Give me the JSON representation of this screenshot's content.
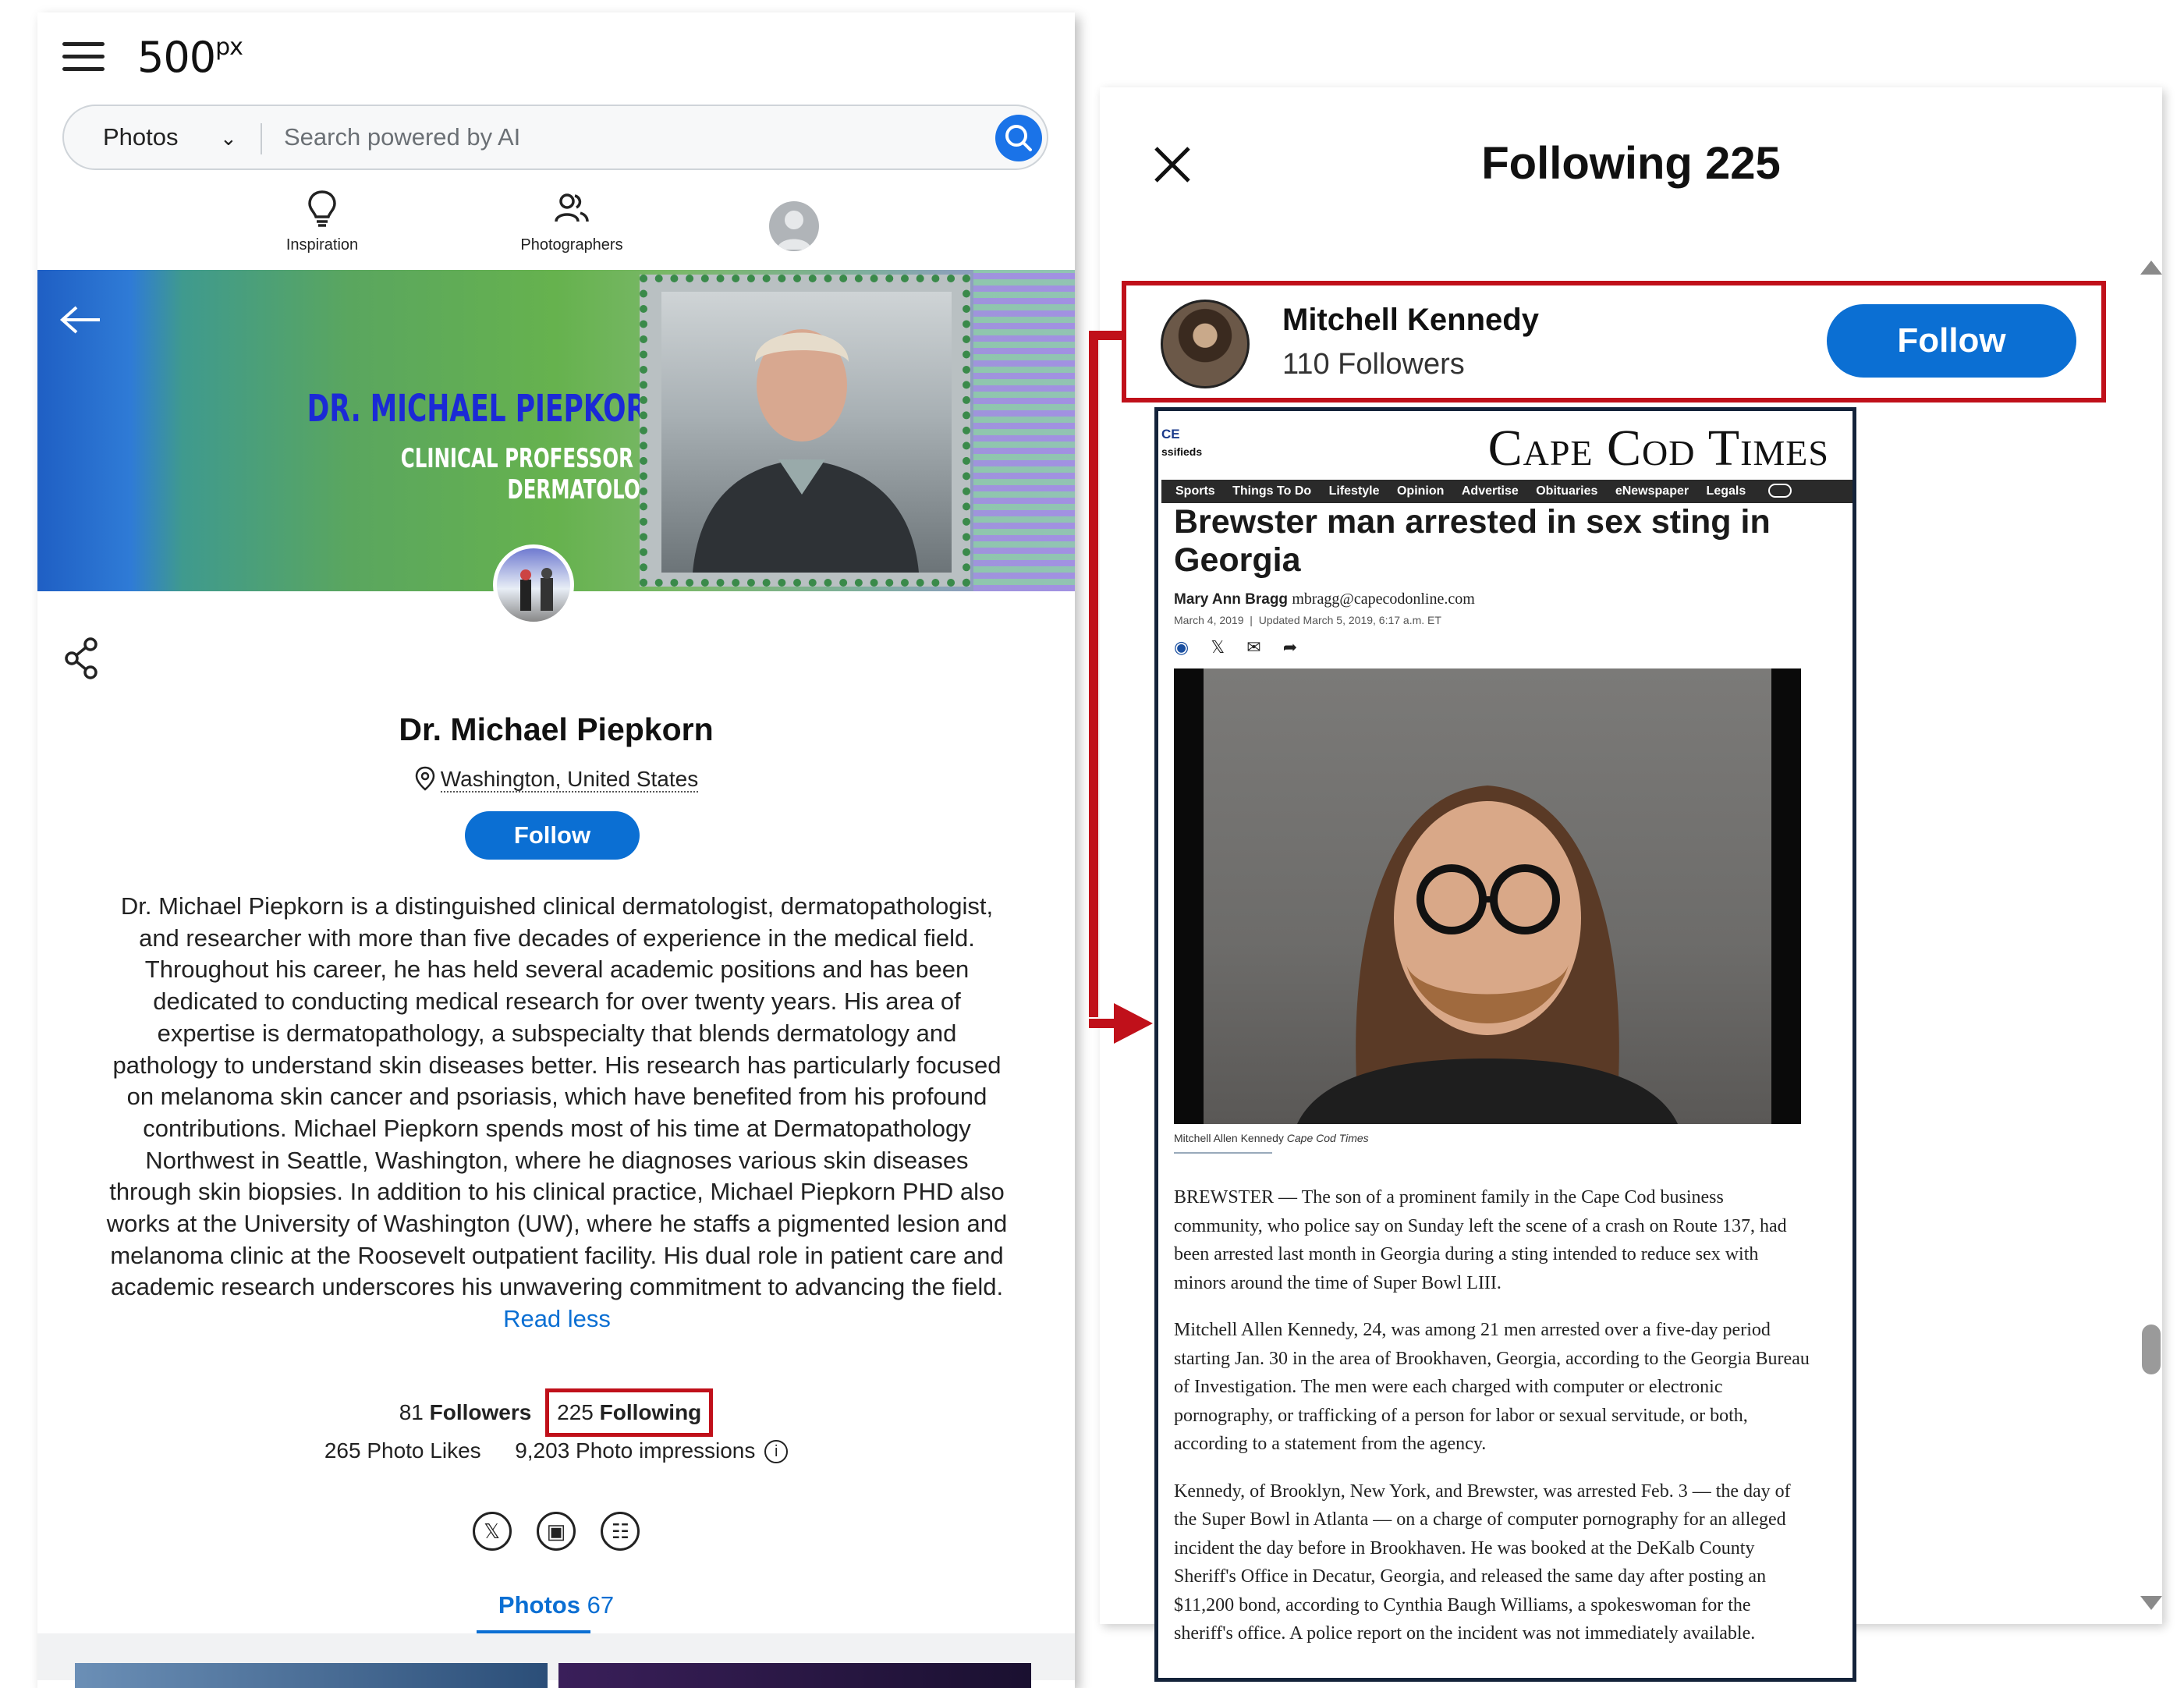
{
  "profile_app": {
    "logo_main": "500",
    "logo_sup": "px",
    "search": {
      "category": "Photos",
      "placeholder": "Search powered by AI"
    },
    "nav": {
      "inspiration": "Inspiration",
      "photographers": "Photographers"
    },
    "cover": {
      "name": "DR. MICHAEL PIEPKORN",
      "subtitle": "CLINICAL PROFESSOR OF DERMATOLOGY"
    },
    "profile": {
      "name": "Dr. Michael Piepkorn",
      "location": "Washington, United States",
      "follow_label": "Follow",
      "bio": "Dr. Michael Piepkorn is a distinguished clinical dermatologist, dermatopathologist, and researcher with more than five decades of experience in the medical field. Throughout his career, he has held several academic positions and has been dedicated to conducting medical research for over twenty years. His area of expertise is dermatopathology, a subspecialty that blends dermatology and pathology to understand skin diseases better. His research has particularly focused on melanoma skin cancer and psoriasis, which have benefited from his profound contributions. Michael Piepkorn spends most of his time at Dermatopathology Northwest in Seattle, Washington, where he diagnoses various skin diseases through skin biopsies. In addition to his clinical practice, Michael Piepkorn PHD also works at the University of Washington (UW), where he staffs a pigmented lesion and melanoma clinic at the Roosevelt outpatient facility. His dual role in patient care and academic research underscores his unwavering commitment to advancing the field.",
      "read_less": "Read less"
    },
    "stats": {
      "followers_count": "81",
      "followers_label": "Followers",
      "following_count": "225",
      "following_label": "Following",
      "photo_likes": "265 Photo Likes",
      "photo_impressions": "9,203 Photo impressions"
    },
    "tabs": {
      "photos_label": "Photos",
      "photos_count": "67"
    }
  },
  "following_modal": {
    "title": "Following 225",
    "user": {
      "name": "Mitchell Kennedy",
      "followers": "110 Followers",
      "follow_label": "Follow"
    }
  },
  "news_article": {
    "corner_ce": "CE",
    "corner_ssified": "ssifieds",
    "masthead": "Cape Cod Times",
    "nav": [
      "Sports",
      "Things To Do",
      "Lifestyle",
      "Opinion",
      "Advertise",
      "Obituaries",
      "eNewspaper",
      "Legals"
    ],
    "headline": "Brewster man arrested in sex sting in Georgia",
    "author": "Mary Ann Bragg",
    "author_email": "mbragg@capecodonline.com",
    "date_published": "March 4, 2019",
    "date_updated": "Updated March 5, 2019, 6:17 a.m. ET",
    "photo_caption_name": "Mitchell Allen Kennedy",
    "photo_caption_source": "Cape Cod Times",
    "paragraphs": [
      "BREWSTER — The son of a prominent family in the Cape Cod business community, who police say on Sunday left the scene of a crash on Route 137, had been arrested last month in Georgia during a sting intended to reduce sex with minors around the time of Super Bowl LIII.",
      "Mitchell Allen Kennedy, 24, was among 21 men arrested over a five-day period starting Jan. 30 in the area of Brookhaven, Georgia, according to the Georgia Bureau of Investigation. The men were each charged with computer or electronic pornography, or trafficking of a person for labor or sexual servitude, or both, according to a statement from the agency.",
      "Kennedy, of Brooklyn, New York, and Brewster, was arrested Feb. 3 — the day of the Super Bowl in Atlanta — on a charge of computer pornography for an alleged incident the day before in Brookhaven. He was booked at the DeKalb County Sheriff's Office in Decatur, Georgia, and released the same day after posting an $11,200 bond, according to Cynthia Baugh Williams, a spokeswoman for the sheriff's office. A police report on the incident was not immediately available."
    ]
  },
  "colors": {
    "brand_blue": "#0b6fd3",
    "highlight_red": "#c0101a"
  }
}
